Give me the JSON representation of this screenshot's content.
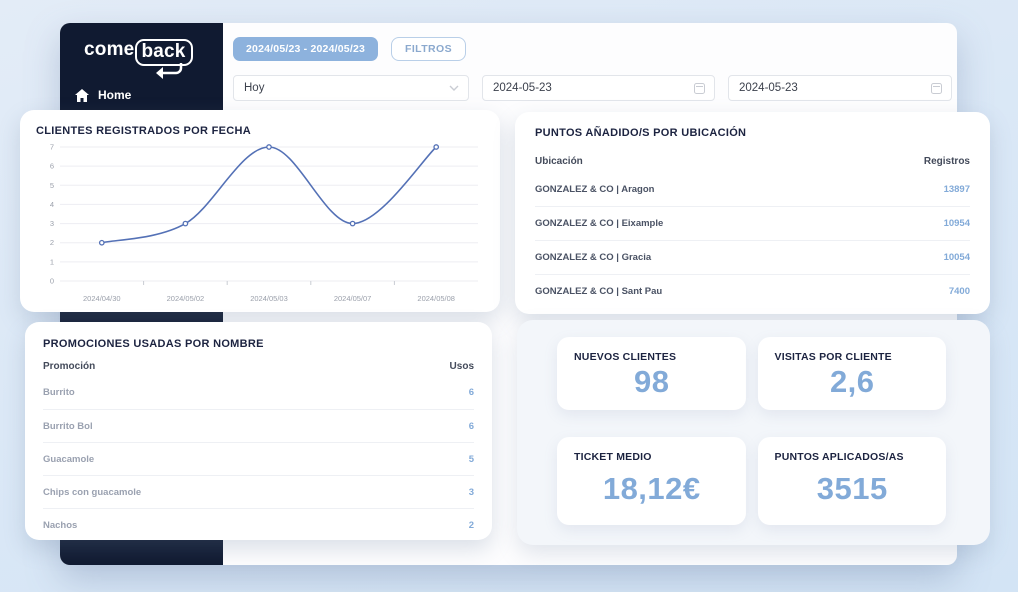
{
  "sidebar": {
    "logo_part1": "come",
    "logo_part2": "back",
    "items": [
      {
        "label": "Home",
        "icon": "home-icon"
      }
    ]
  },
  "topbar": {
    "date_range_badge": "2024/05/23 - 2024/05/23",
    "filters_button": "FILTROS",
    "period_select_value": "Hoy",
    "date_from": "2024-05-23",
    "date_to": "2024-05-23"
  },
  "cards": {
    "clientes": {
      "title": "CLIENTES REGISTRADOS POR FECHA"
    },
    "puntos": {
      "title": "PUNTOS AÑADIDO/S POR UBICACIÓN",
      "col_left": "Ubicación",
      "col_right": "Registros",
      "rows": [
        {
          "label": "GONZALEZ & CO | Aragon",
          "value": "13897"
        },
        {
          "label": "GONZALEZ & CO | Eixample",
          "value": "10954"
        },
        {
          "label": "GONZALEZ & CO | Gracia",
          "value": "10054"
        },
        {
          "label": "GONZALEZ & CO | Sant Pau",
          "value": "7400"
        }
      ]
    },
    "promos": {
      "title": "PROMOCIONES USADAS POR NOMBRE",
      "col_left": "Promoción",
      "col_right": "Usos",
      "rows": [
        {
          "label": "Burrito",
          "value": "6"
        },
        {
          "label": "Burrito Bol",
          "value": "6"
        },
        {
          "label": "Guacamole",
          "value": "5"
        },
        {
          "label": "Chips con guacamole",
          "value": "3"
        },
        {
          "label": "Nachos",
          "value": "2"
        }
      ]
    },
    "kpis": [
      {
        "title": "NUEVOS CLIENTES",
        "value": "98"
      },
      {
        "title": "VISITAS POR CLIENTE",
        "value": "2,6"
      },
      {
        "title": "TICKET MEDIO",
        "value": "18,12€"
      },
      {
        "title": "PUNTOS APLICADOS/AS",
        "value": "3515"
      }
    ]
  },
  "chart_data": {
    "type": "line",
    "title": "CLIENTES REGISTRADOS POR FECHA",
    "categories": [
      "2024/04/30",
      "2024/05/02",
      "2024/05/03",
      "2024/05/07",
      "2024/05/08"
    ],
    "values": [
      2,
      3,
      7,
      3,
      7
    ],
    "ylim": [
      0,
      7
    ],
    "yticks": [
      0,
      1,
      2,
      3,
      4,
      5,
      6,
      7
    ],
    "grid": true,
    "legend": "none",
    "line_color": "#5471b6",
    "grid_color": "#ededf2",
    "axis_text_color": "#9ba0ab",
    "smooth": true
  },
  "colors": {
    "sidebar_bg": "#101a31",
    "badge_bg": "#8db2dd",
    "accent_blue": "#82aad8",
    "title_dark": "#1c2340"
  }
}
